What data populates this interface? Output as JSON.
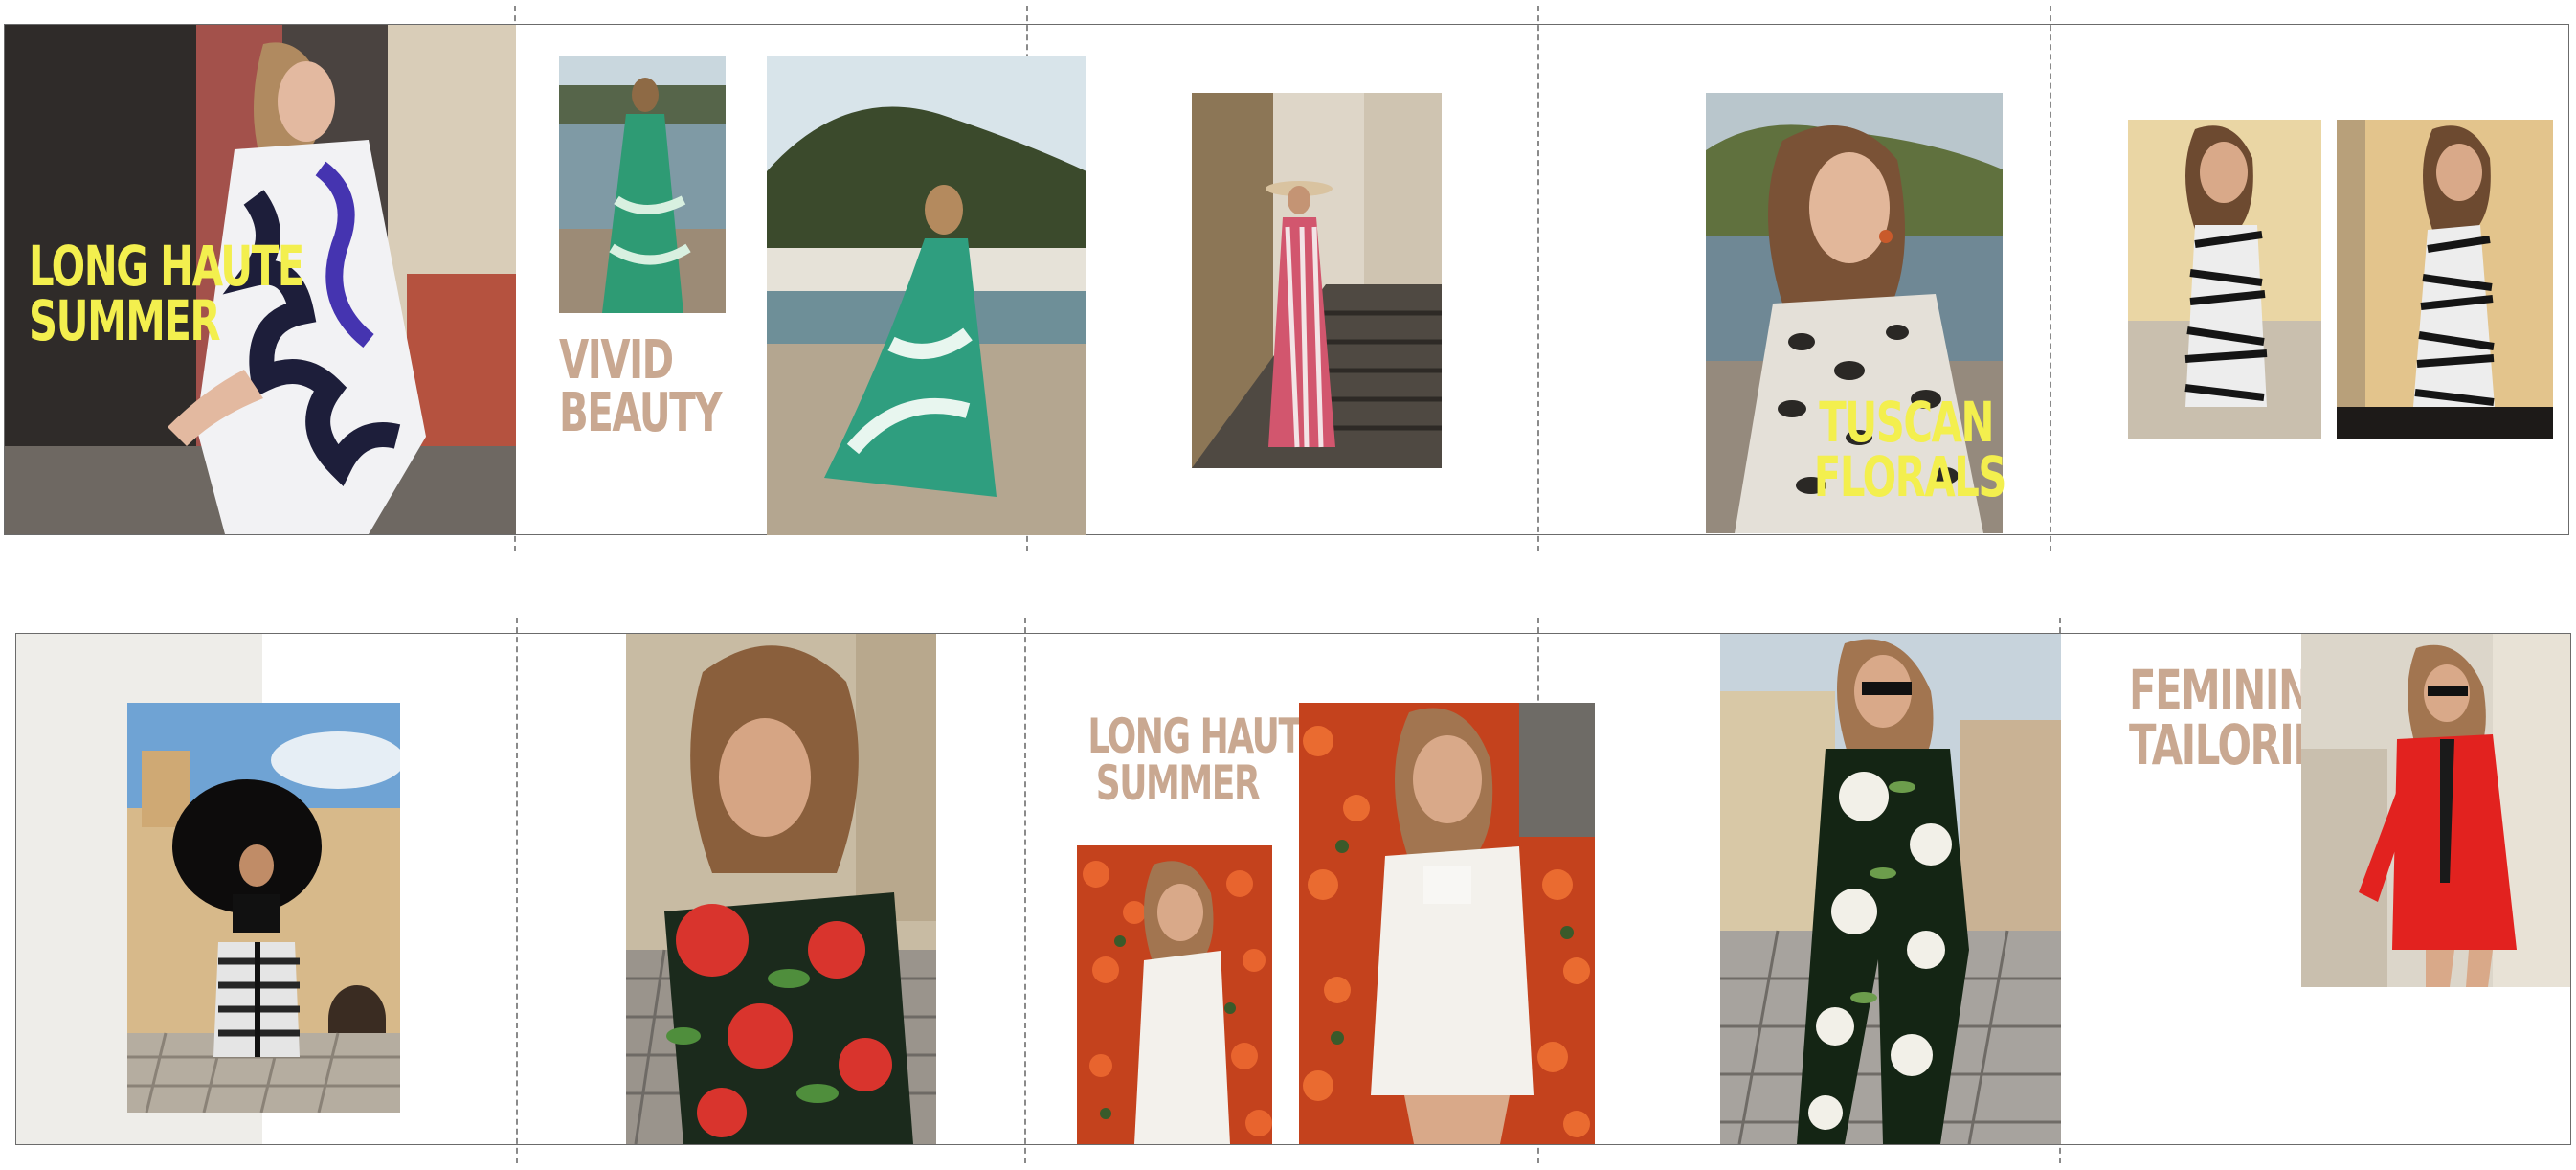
{
  "panels": [
    {
      "label_lines": [
        "LONG HAUTE",
        "SUMMER"
      ],
      "label_color": "#f3ef4e"
    },
    {
      "label_lines": [
        "VIVID",
        "BEAUTY"
      ],
      "label_color": "#c9a891"
    },
    {
      "label_lines": [
        "TUSCAN",
        "FLORALS"
      ],
      "label_color": "#f3ef4e"
    },
    {
      "label_lines": [
        "LONG HAUTE",
        "SUMMER"
      ],
      "label_color": "#c9a891"
    },
    {
      "label_lines": [
        "FEMININE",
        "TAILORING"
      ],
      "label_color": "#c9a891"
    }
  ],
  "colors": {
    "yellow": "#f3ef4e",
    "tan": "#c9a891",
    "fold_line": "#8a8a8a",
    "border": "#6b6b6b"
  }
}
